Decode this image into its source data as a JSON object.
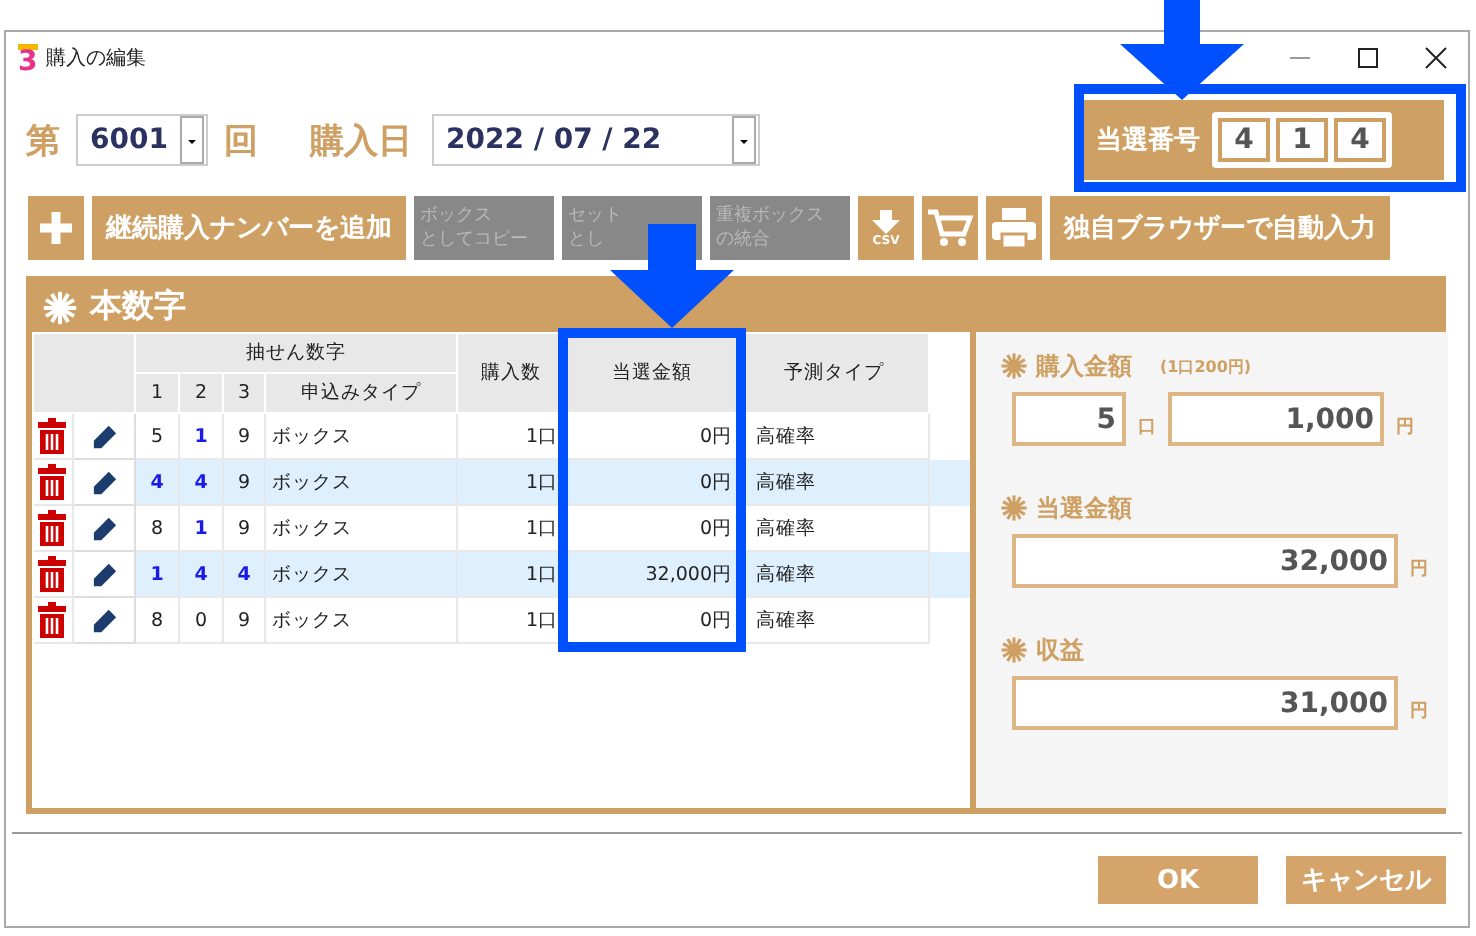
{
  "window": {
    "app_icon": "3",
    "title": "購入の編集"
  },
  "draw": {
    "prefix": "第",
    "number": "6001",
    "suffix": "回",
    "date_label": "購入日",
    "date": "2022 / 07 / 22"
  },
  "winning": {
    "label": "当選番号",
    "digits": [
      "4",
      "1",
      "4"
    ]
  },
  "toolbar": [
    {
      "kind": "add",
      "disabled": false
    },
    {
      "kind": "text",
      "lines": [
        "継続購入ナンバーを追加"
      ],
      "disabled": false
    },
    {
      "kind": "text",
      "lines": [
        "ボックス",
        "としてコピー"
      ],
      "disabled": true
    },
    {
      "kind": "text",
      "lines": [
        "セット",
        "とし"
      ],
      "disabled": true
    },
    {
      "kind": "text",
      "lines": [
        "重複ボックス",
        "の統合"
      ],
      "disabled": true
    },
    {
      "kind": "csv",
      "label": "CSV",
      "disabled": false
    },
    {
      "kind": "cart",
      "disabled": false
    },
    {
      "kind": "print",
      "disabled": false
    },
    {
      "kind": "text",
      "lines": [
        "独自ブラウザーで自動入力"
      ],
      "disabled": false
    }
  ],
  "panel": {
    "title": "本数字"
  },
  "table": {
    "group_header": "抽せん数字",
    "digit_headers": [
      "1",
      "2",
      "3"
    ],
    "type_header": "申込みタイプ",
    "count_header": "購入数",
    "prize_header": "当選金額",
    "predict_header": "予測タイプ",
    "rows": [
      {
        "digits": [
          {
            "value": "5",
            "match": false
          },
          {
            "value": "1",
            "match": true
          },
          {
            "value": "9",
            "match": false
          }
        ],
        "type": "ボックス",
        "count": "1口",
        "prize": "0円",
        "predict": "高確率"
      },
      {
        "digits": [
          {
            "value": "4",
            "match": true
          },
          {
            "value": "4",
            "match": true
          },
          {
            "value": "9",
            "match": false
          }
        ],
        "type": "ボックス",
        "count": "1口",
        "prize": "0円",
        "predict": "高確率"
      },
      {
        "digits": [
          {
            "value": "8",
            "match": false
          },
          {
            "value": "1",
            "match": true
          },
          {
            "value": "9",
            "match": false
          }
        ],
        "type": "ボックス",
        "count": "1口",
        "prize": "0円",
        "predict": "高確率"
      },
      {
        "digits": [
          {
            "value": "1",
            "match": true
          },
          {
            "value": "4",
            "match": true
          },
          {
            "value": "4",
            "match": true
          }
        ],
        "type": "ボックス",
        "count": "1口",
        "prize": "32,000円",
        "predict": "高確率"
      },
      {
        "digits": [
          {
            "value": "8",
            "match": false
          },
          {
            "value": "0",
            "match": false
          },
          {
            "value": "9",
            "match": false
          }
        ],
        "type": "ボックス",
        "count": "1口",
        "prize": "0円",
        "predict": "高確率"
      }
    ]
  },
  "summary": {
    "purchase": {
      "label": "購入金額",
      "note": "(1口200円)",
      "units": "5",
      "units_suffix": "口",
      "amount": "1,000",
      "amount_suffix": "円"
    },
    "winnings": {
      "label": "当選金額",
      "value": "32,000",
      "suffix": "円"
    },
    "profit": {
      "label": "収益",
      "value": "31,000",
      "suffix": "円"
    }
  },
  "buttons": [
    {
      "label": "OK"
    },
    {
      "label": "キャンセル"
    }
  ]
}
